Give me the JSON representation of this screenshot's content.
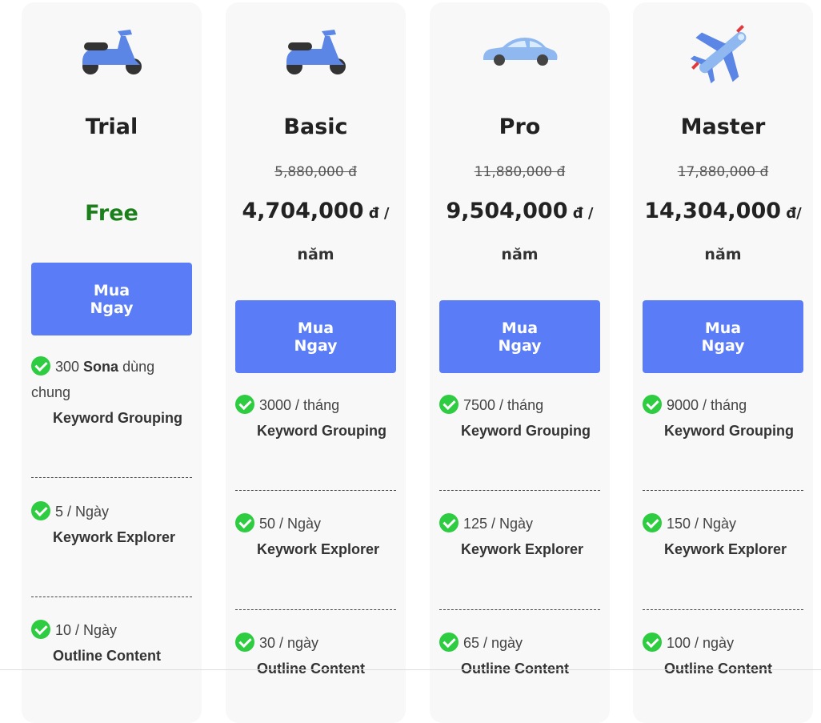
{
  "colors": {
    "button": "#5b7cf7",
    "free_text": "#1b7f1b",
    "check": "#2ecc40",
    "card_bg": "#f8f8f8"
  },
  "plans": [
    {
      "icon": "scooter-icon",
      "name": "Trial",
      "price": "Free",
      "buy_label": "Mua Ngay",
      "features": [
        {
          "prefix": "300 ",
          "bold": "Sona",
          "suffix": " dùng chung",
          "title": "Keyword Grouping"
        },
        {
          "prefix": "5 / Ngày",
          "title": "Keywork Explorer"
        },
        {
          "prefix": "10 / Ngày",
          "title": "Outline Content"
        }
      ]
    },
    {
      "icon": "scooter-icon",
      "name": "Basic",
      "old_price": "5,880,000 đ",
      "price": "4,704,000",
      "unit": " đ /",
      "period": "năm",
      "buy_label": "Mua Ngay",
      "features": [
        {
          "prefix": "3000 / tháng",
          "title": "Keyword Grouping"
        },
        {
          "prefix": "50 / Ngày",
          "title": "Keywork Explorer"
        },
        {
          "prefix": "30 / ngày",
          "title": "Outline Content"
        }
      ]
    },
    {
      "icon": "car-icon",
      "name": "Pro",
      "old_price": "11,880,000 đ",
      "price": "9,504,000",
      "unit": " đ /",
      "period": "năm",
      "buy_label": "Mua Ngay",
      "features": [
        {
          "prefix": "7500 / tháng",
          "title": "Keyword Grouping"
        },
        {
          "prefix": "125 / Ngày",
          "title": "Keywork Explorer"
        },
        {
          "prefix": "65 / ngày",
          "title": "Outline Content"
        }
      ]
    },
    {
      "icon": "airplane-icon",
      "name": "Master",
      "old_price": "17,880,000 đ",
      "price": "14,304,000",
      "unit": " đ/",
      "period": "năm",
      "buy_label": "Mua Ngay",
      "features": [
        {
          "prefix": "9000 / tháng",
          "title": "Keyword Grouping"
        },
        {
          "prefix": "150 / Ngày",
          "title": "Keywork Explorer"
        },
        {
          "prefix": "100 / ngày",
          "title": "Outline Content"
        }
      ]
    }
  ]
}
